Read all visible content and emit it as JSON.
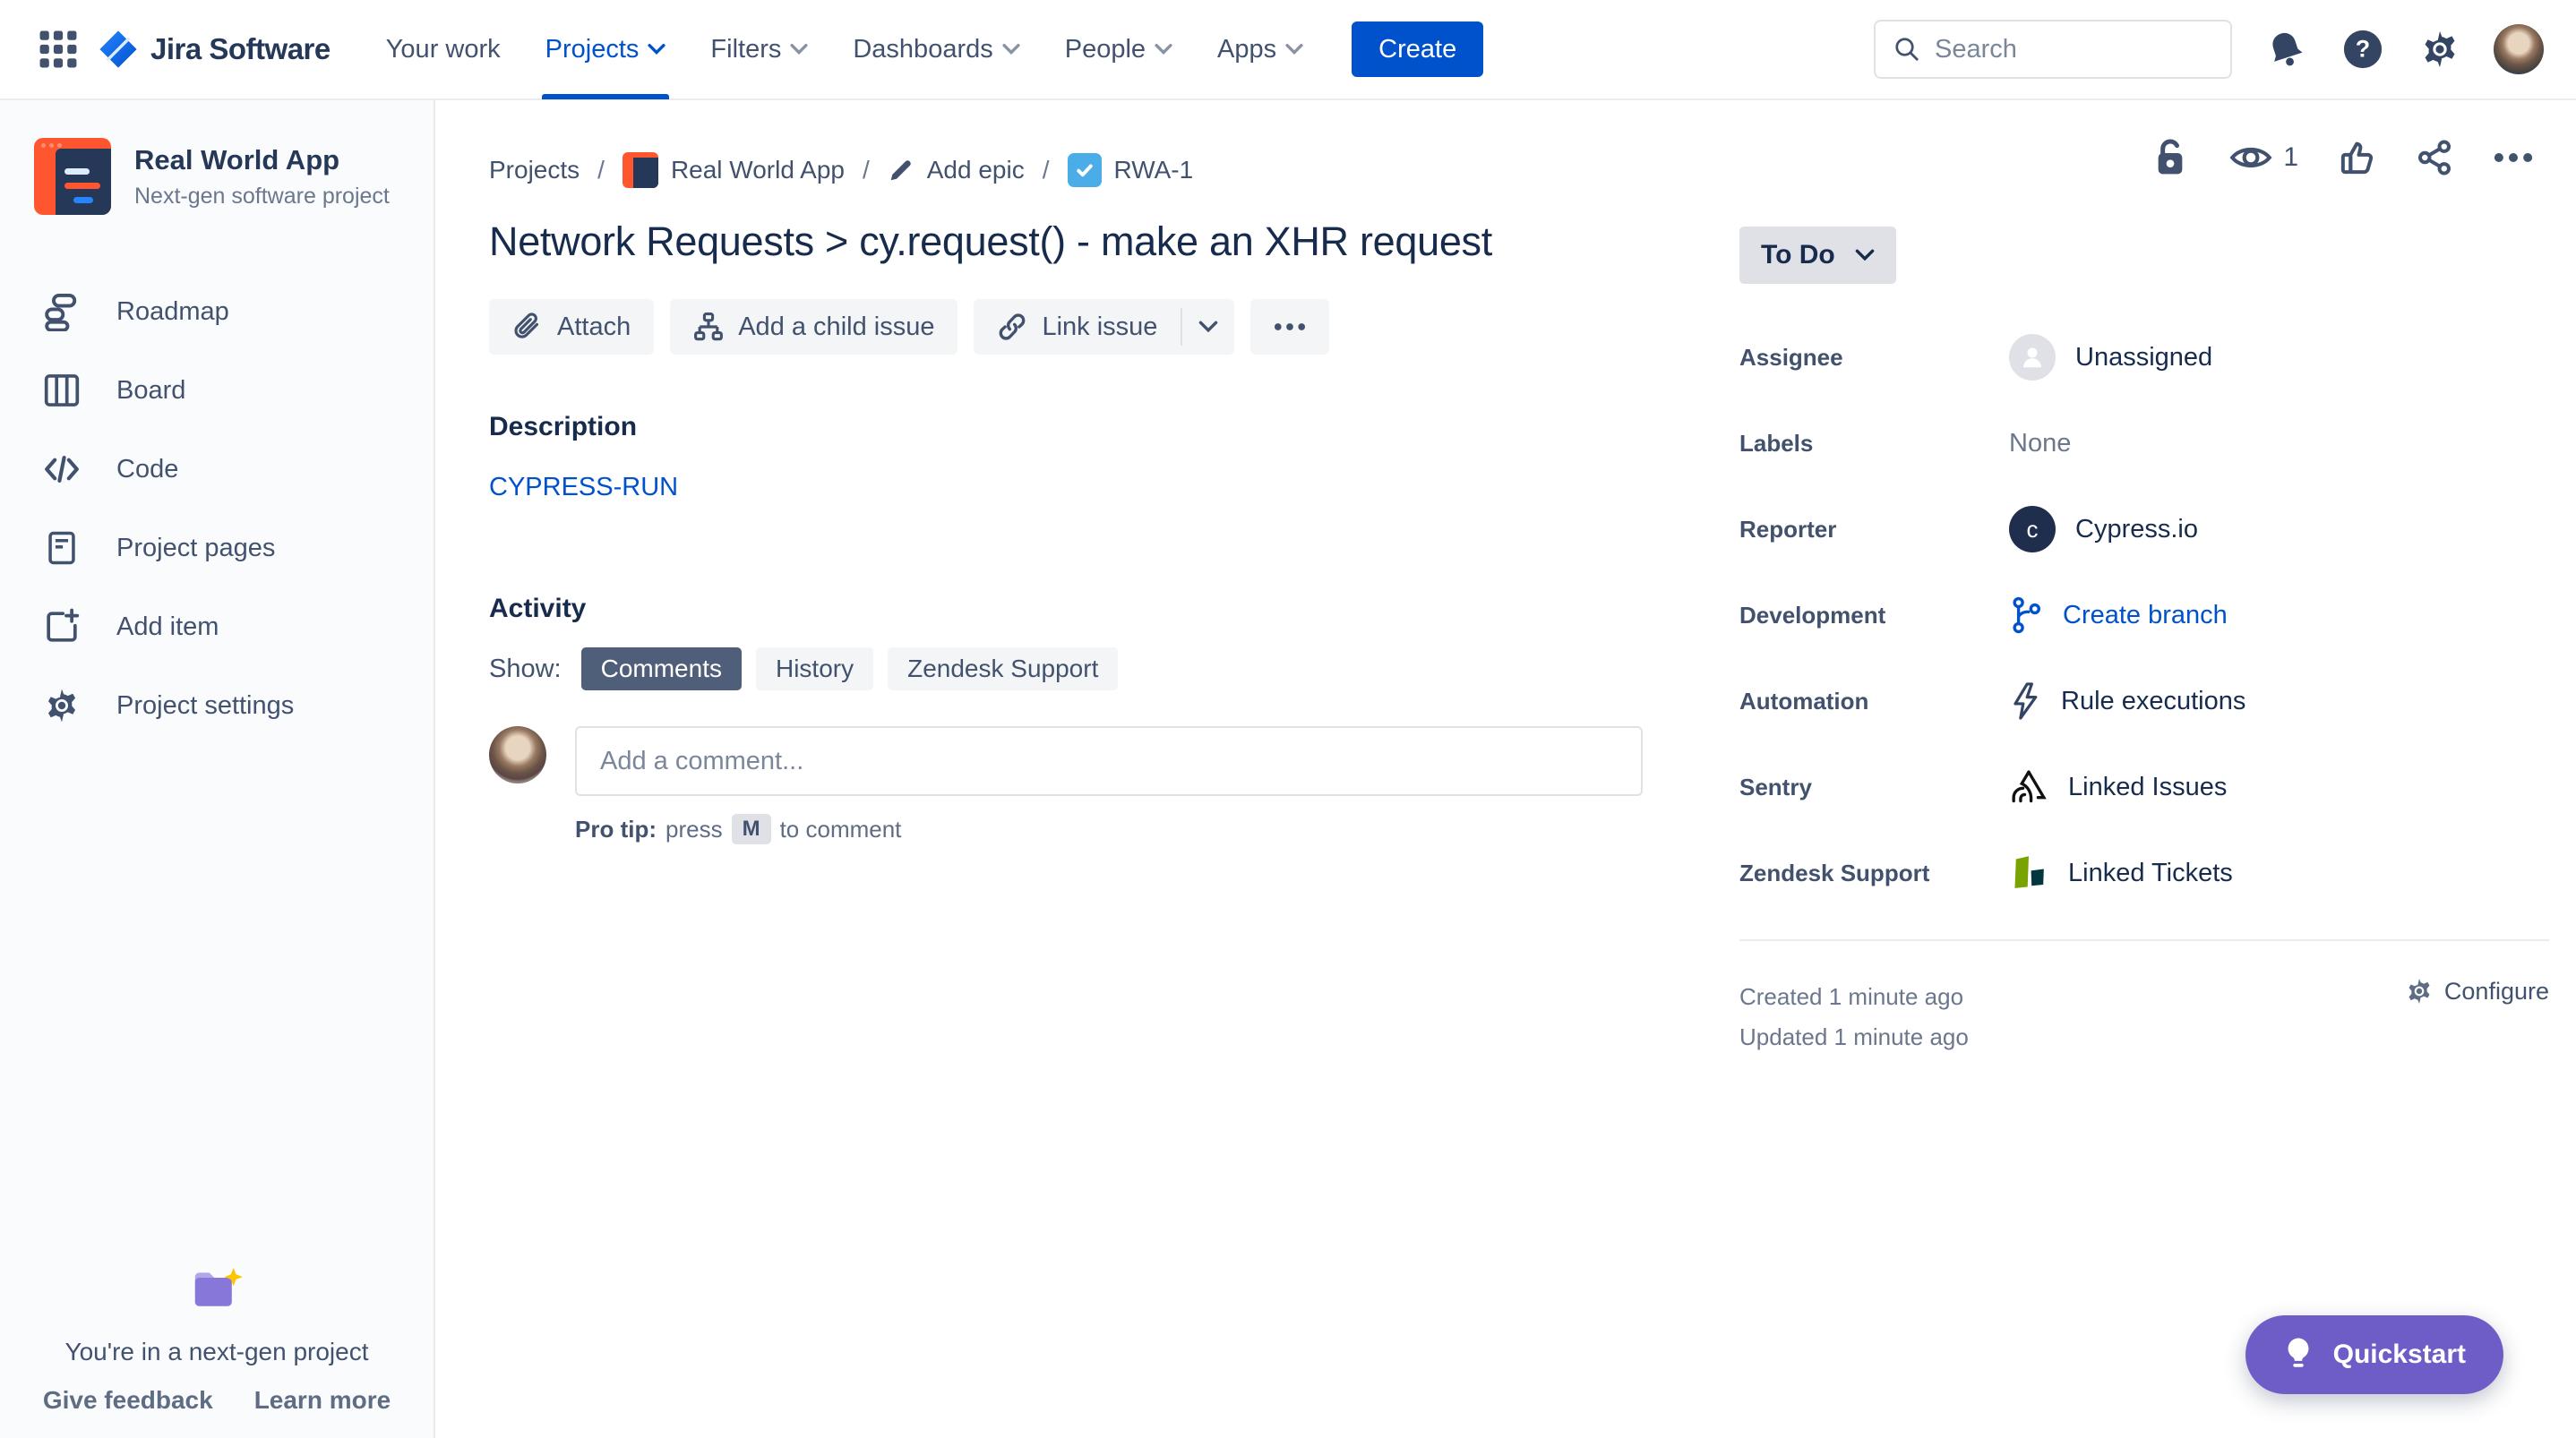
{
  "app": {
    "brand": "Jira Software"
  },
  "header": {
    "nav_items": [
      {
        "label": "Your work"
      },
      {
        "label": "Projects"
      },
      {
        "label": "Filters"
      },
      {
        "label": "Dashboards"
      },
      {
        "label": "People"
      },
      {
        "label": "Apps"
      }
    ],
    "create_label": "Create",
    "search_placeholder": "Search"
  },
  "sidebar": {
    "project_name": "Real World App",
    "project_type": "Next-gen software project",
    "items": [
      {
        "label": "Roadmap"
      },
      {
        "label": "Board"
      },
      {
        "label": "Code"
      },
      {
        "label": "Project pages"
      },
      {
        "label": "Add item"
      },
      {
        "label": "Project settings"
      }
    ],
    "footer": {
      "message": "You're in a next-gen project",
      "feedback_label": "Give feedback",
      "learn_label": "Learn more"
    }
  },
  "breadcrumb": {
    "separator": "/",
    "projects": "Projects",
    "project": "Real World App",
    "epic": "Add epic",
    "issue_key": "RWA-1"
  },
  "issue": {
    "title": "Network Requests > cy.request() - make an XHR request",
    "watchers_count": "1",
    "attach_label": "Attach",
    "child_issue_label": "Add a child issue",
    "link_issue_label": "Link issue",
    "description_label": "Description",
    "description_link": "CYPRESS-RUN",
    "activity_label": "Activity",
    "show_label": "Show:",
    "tabs": [
      {
        "label": "Comments"
      },
      {
        "label": "History"
      },
      {
        "label": "Zendesk Support"
      }
    ],
    "comment_placeholder": "Add a comment...",
    "protip": {
      "prefix": "Pro tip:",
      "press": "press",
      "key": "M",
      "suffix": "to comment"
    }
  },
  "details": {
    "status_label": "To Do",
    "fields": [
      {
        "label": "Assignee",
        "value": "Unassigned"
      },
      {
        "label": "Labels",
        "value": "None"
      },
      {
        "label": "Reporter",
        "value": "Cypress.io"
      },
      {
        "label": "Development",
        "value": "Create branch"
      },
      {
        "label": "Automation",
        "value": "Rule executions"
      },
      {
        "label": "Sentry",
        "value": "Linked Issues"
      },
      {
        "label": "Zendesk Support",
        "value": "Linked Tickets"
      }
    ],
    "reporter_initial": "c",
    "created": "Created 1 minute ago",
    "updated": "Updated 1 minute ago",
    "configure_label": "Configure"
  },
  "quickstart": {
    "label": "Quickstart"
  },
  "colors": {
    "accent": "#0052CC",
    "navy": "#172B4D",
    "slate": "#42526E",
    "active_pill": "#505F79",
    "purple": "#6E5DC6",
    "task_blue": "#4BADE8",
    "project_orange": "#FF5630",
    "zendesk_green": "#78A300",
    "zendesk_teal": "#03363D"
  }
}
